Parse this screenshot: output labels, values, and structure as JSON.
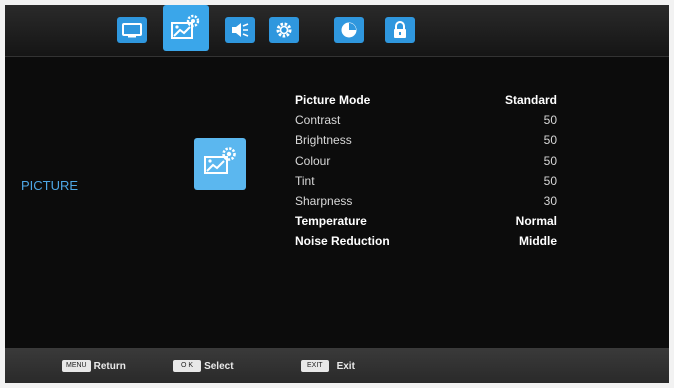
{
  "tabs": [
    {
      "icon": "tv-icon"
    },
    {
      "icon": "picture-settings-icon",
      "active": true
    },
    {
      "icon": "speaker-icon"
    },
    {
      "icon": "gear-icon"
    },
    {
      "icon": "clock-icon"
    },
    {
      "icon": "lock-icon"
    }
  ],
  "section_title": "PICTURE",
  "menu": {
    "items": [
      {
        "label": "Picture Mode",
        "value": "Standard"
      },
      {
        "label": "Contrast",
        "value": "50"
      },
      {
        "label": "Brightness",
        "value": "50"
      },
      {
        "label": "Colour",
        "value": "50"
      },
      {
        "label": "Tint",
        "value": "50"
      },
      {
        "label": "Sharpness",
        "value": "30"
      },
      {
        "label": "Temperature",
        "value": "Normal"
      },
      {
        "label": "Noise Reduction",
        "value": "Middle"
      }
    ]
  },
  "footer": {
    "menu_key": "MENU",
    "return_label": "Return",
    "ok_key": "O K",
    "select_label": "Select",
    "exit_key": "EXIT",
    "exit_label": "Exit"
  },
  "colors": {
    "accent": "#2f97de",
    "section_title": "#4ea7e6",
    "background": "#0c0c0c"
  }
}
